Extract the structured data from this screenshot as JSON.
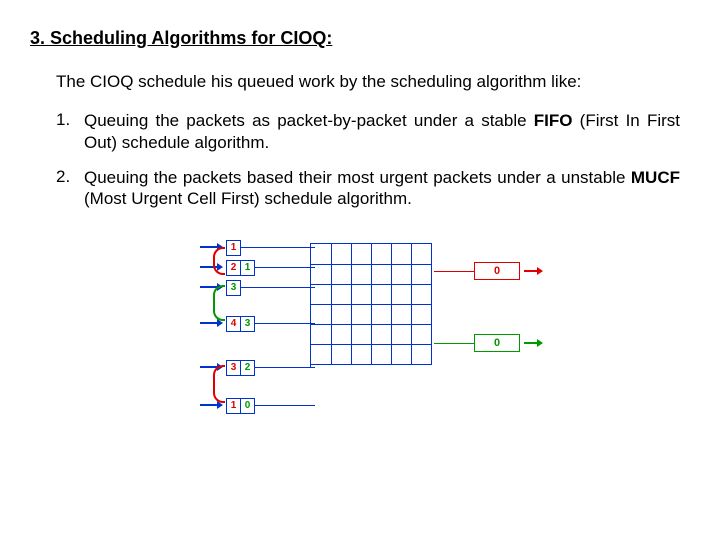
{
  "heading": "3. Scheduling Algorithms for CIOQ:",
  "intro": "The CIOQ schedule his queued work by the scheduling algorithm like:",
  "items": [
    {
      "num": "1.",
      "pre": "Queuing the packets as packet-by-packet under a stable ",
      "bold": "FIFO",
      "post": " (First In First Out) schedule algorithm."
    },
    {
      "num": "2.",
      "pre": "Queuing the packets based their most urgent packets under a unstable ",
      "bold": "MUCF",
      "post": " (Most Urgent Cell First) schedule algorithm."
    }
  ],
  "diagram": {
    "inputs": [
      {
        "cells": [
          {
            "t": "1",
            "c": "red"
          }
        ]
      },
      {
        "cells": [
          {
            "t": "2",
            "c": "red"
          },
          {
            "t": "1",
            "c": "green"
          }
        ]
      },
      {
        "cells": [
          {
            "t": "3",
            "c": "green"
          }
        ]
      },
      {
        "cells": [
          {
            "t": "4",
            "c": "red"
          },
          {
            "t": "3",
            "c": "green"
          }
        ]
      },
      {
        "cells": [
          {
            "t": "3",
            "c": "red"
          },
          {
            "t": "2",
            "c": "green"
          }
        ]
      },
      {
        "cells": [
          {
            "t": "1",
            "c": "red"
          },
          {
            "t": "0",
            "c": "green"
          }
        ]
      }
    ],
    "outputs": [
      {
        "label": "0",
        "color": "#e00000"
      },
      {
        "label": "0",
        "color": "#009900"
      }
    ]
  }
}
